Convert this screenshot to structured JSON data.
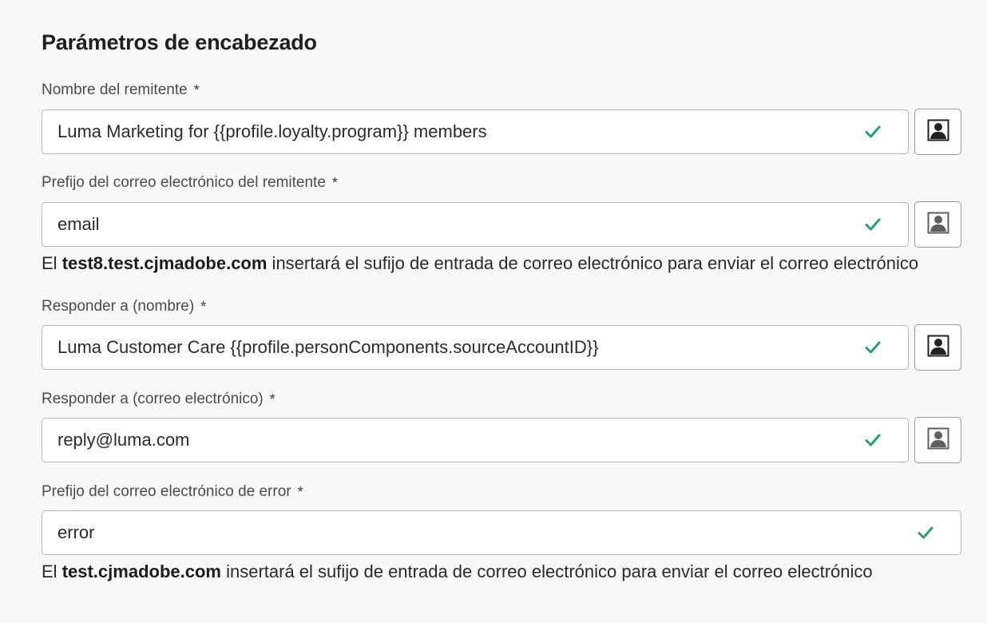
{
  "section": {
    "title": "Parámetros de encabezado"
  },
  "fields": [
    {
      "label": "Nombre del remitente",
      "required_mark": "*",
      "value": "Luma Marketing for {{profile.loyalty.program}} members",
      "valid_icon": "checkmark-icon",
      "personalize_icon": "personalization-icon"
    },
    {
      "label": "Prefijo del correo electrónico del remitente",
      "required_mark": "*",
      "value": "email",
      "valid_icon": "checkmark-icon",
      "personalize_icon": "personalization-icon"
    },
    {
      "label": "Responder a (nombre)",
      "required_mark": "*",
      "value": "Luma Customer Care {{profile.personComponents.sourceAccountID}}",
      "valid_icon": "checkmark-icon",
      "personalize_icon": "personalization-icon"
    },
    {
      "label": "Responder a (correo electrónico)",
      "required_mark": "*",
      "value": "reply@luma.com",
      "valid_icon": "checkmark-icon",
      "personalize_icon": "personalization-icon"
    },
    {
      "label": "Prefijo del correo electrónico de error",
      "required_mark": "*",
      "value": "error",
      "valid_icon": "checkmark-icon"
    }
  ],
  "help_texts": [
    {
      "prefix": "El ",
      "domain": "test8.test.cjmadobe.com",
      "suffix": " insertará el sufijo de entrada de correo electrónico para enviar el correo electrónico"
    },
    {
      "prefix": "El ",
      "domain": "test.cjmadobe.com",
      "suffix": " insertará el sufijo de entrada de correo electrónico para enviar el correo electrónico"
    }
  ],
  "colors": {
    "valid": "#2d9d78",
    "background": "#f8f8f8",
    "field_border": "#b8b8b8"
  }
}
